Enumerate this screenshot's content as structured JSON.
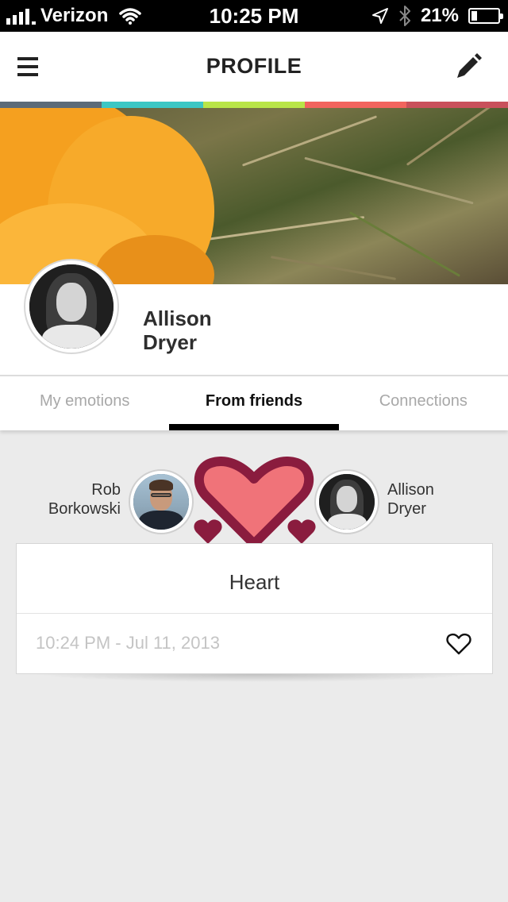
{
  "status_bar": {
    "carrier": "Verizon",
    "time": "10:25 PM",
    "battery_percent": "21%",
    "battery_level": 0.21,
    "icons": [
      "signal-icon",
      "wifi-icon",
      "location-icon",
      "bluetooth-icon",
      "battery-icon"
    ]
  },
  "header": {
    "title": "PROFILE",
    "menu_icon": "hamburger-menu-icon",
    "edit_icon": "pencil-icon"
  },
  "color_strip": [
    "#5c6b78",
    "#3cc7c4",
    "#b9e548",
    "#f2645e",
    "#c9505b"
  ],
  "profile": {
    "first_name": "Allison",
    "last_name": "Dryer"
  },
  "tabs": [
    {
      "label": "My emotions",
      "active": false
    },
    {
      "label": "From friends",
      "active": true
    },
    {
      "label": "Connections",
      "active": false
    }
  ],
  "feed": {
    "sender_first": "Rob",
    "sender_last": "Borkowski",
    "recipient_first": "Allison",
    "recipient_last": "Dryer",
    "emotion": "Heart",
    "timestamp": "10:24 PM - Jul 11, 2013",
    "heart_fill": "#f07379",
    "heart_stroke": "#8a1c3e"
  }
}
